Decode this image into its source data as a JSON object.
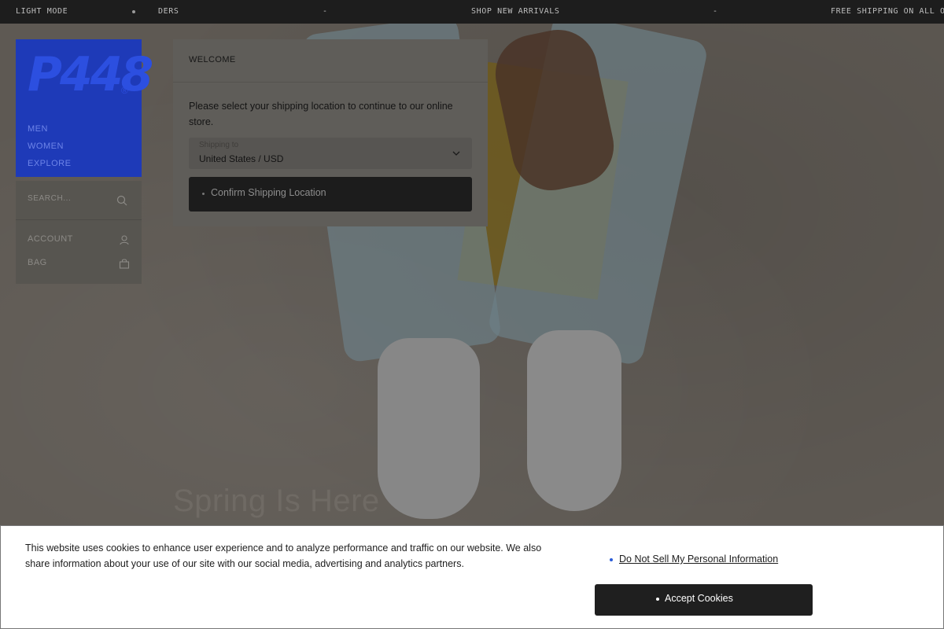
{
  "announcement_bar": {
    "theme_toggle_label": "LIGHT MODE",
    "marquee_items": [
      "DERS",
      "-",
      "SHOP NEW ARRIVALS",
      "-",
      "FREE SHIPPING ON ALL OR"
    ]
  },
  "brand": {
    "logo_text": "P448",
    "logo_reg": "®",
    "accent_color": "#1e3ab8"
  },
  "nav": {
    "items": [
      {
        "label": "MEN"
      },
      {
        "label": "WOMEN"
      },
      {
        "label": "EXPLORE"
      }
    ]
  },
  "tools": {
    "search_placeholder": "SEARCH...",
    "account_label": "ACCOUNT",
    "bag_label": "BAG"
  },
  "hero": {
    "title": "Spring Is Here"
  },
  "modal": {
    "title": "WELCOME",
    "message": "Please select your shipping location to continue to our online store.",
    "select_label": "Shipping to",
    "select_value": "United States / USD",
    "confirm_label": "Confirm Shipping Location"
  },
  "cookie_banner": {
    "text": "This website uses cookies to enhance user experience and to analyze performance and traffic on our website. We also share information about your use of our site with our social media, advertising and analytics partners.",
    "do_not_sell_label": "Do Not Sell My Personal Information",
    "accept_label": "Accept Cookies"
  }
}
